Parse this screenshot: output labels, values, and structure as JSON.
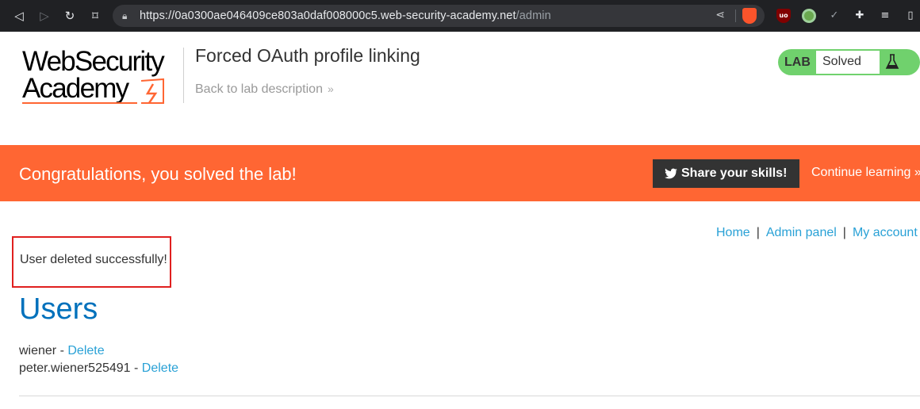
{
  "browser": {
    "url_host": "https://0a0300ae046409ce803a0daf008000c5.web-security-academy.net",
    "url_path": "/admin",
    "icons": [
      "back-icon",
      "forward-icon",
      "reload-icon",
      "bookmark-icon",
      "lock-icon",
      "share-icon",
      "brave-shield-icon",
      "ublock-icon",
      "extension-green-icon",
      "check-icon",
      "puzzle-icon",
      "media-icon",
      "sidebar-icon"
    ]
  },
  "header": {
    "logo_line1": "WebSecurity",
    "logo_line2": "Academy",
    "lab_title": "Forced OAuth profile linking",
    "back_link": "Back to lab description",
    "back_chevron": "»",
    "lab_label": "LAB",
    "lab_status": "Solved"
  },
  "banner": {
    "message": "Congratulations, you solved the lab!",
    "share_label": "Share your skills!",
    "continue_label": "Continue learning",
    "continue_chevron": "»"
  },
  "nav": {
    "home": "Home",
    "admin_panel": "Admin panel",
    "my_account": "My account",
    "separator": "|"
  },
  "main": {
    "notice": "User deleted successfully!",
    "title": "Users",
    "users": [
      {
        "name": "wiener",
        "separator": " - ",
        "action": "Delete"
      },
      {
        "name": "peter.wiener525491",
        "separator": " - ",
        "action": "Delete"
      }
    ]
  },
  "colors": {
    "banner": "#ff6633",
    "lab_badge": "#70d16d",
    "link": "#29a1d6",
    "heading": "#0071bc",
    "highlight_box": "#e0201f"
  }
}
